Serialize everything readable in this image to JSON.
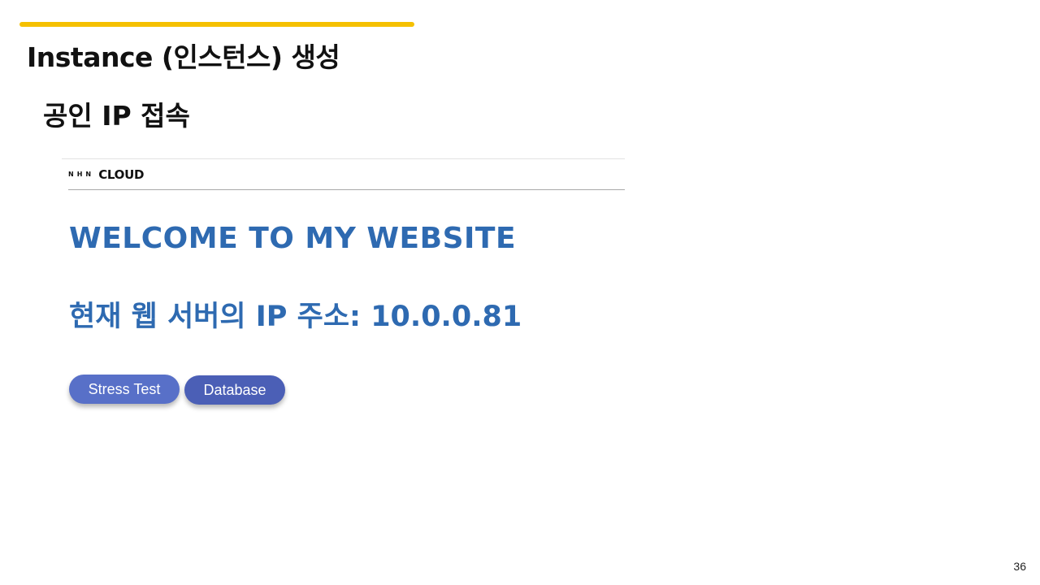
{
  "slide": {
    "title": "Instance (인스턴스) 생성",
    "subtitle": "공인 IP 접속",
    "page_number": "36",
    "accent_color": "#f5c000"
  },
  "website": {
    "logo_small": "NHN",
    "logo_main": "CLOUD",
    "welcome_heading": "WELCOME TO MY WEBSITE",
    "ip_text": "현재 웹 서버의 IP 주소: 10.0.0.81",
    "heading_color": "#2e6ab1",
    "buttons": {
      "stress_test": "Stress Test",
      "database": "Database"
    }
  }
}
